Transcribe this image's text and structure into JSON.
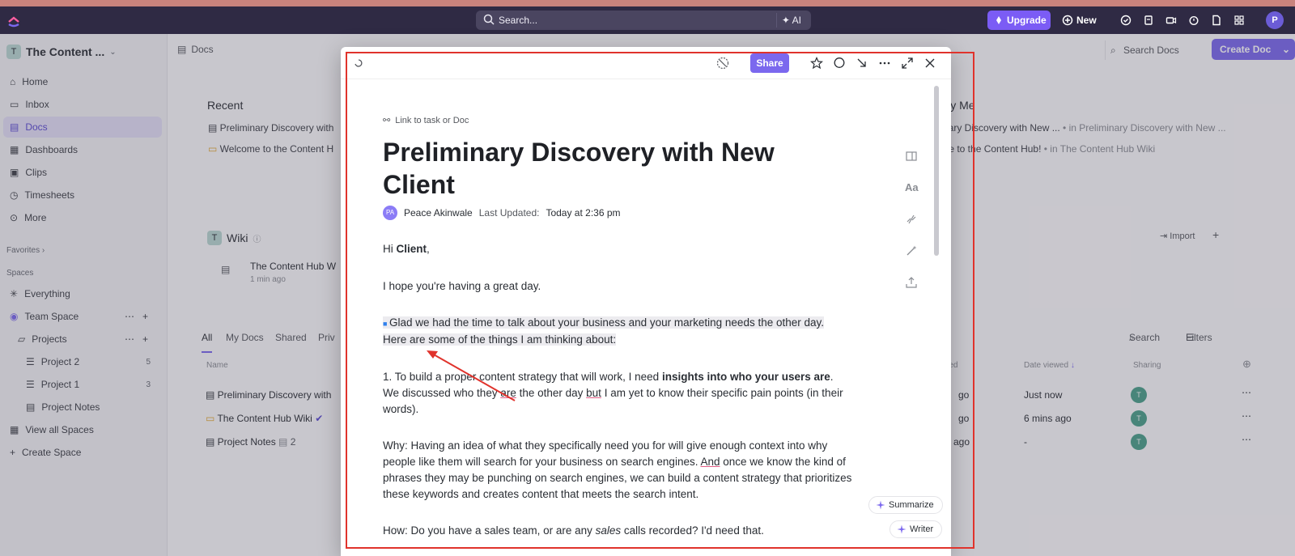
{
  "topbar": {
    "search_placeholder": "Search...",
    "ai_label": "AI",
    "upgrade_label": "Upgrade",
    "new_label": "New",
    "avatar_initial": "P"
  },
  "sidebar": {
    "workspace_badge": "T",
    "workspace_name": "The Content ...",
    "nav": [
      {
        "label": "Home",
        "icon": "home-icon"
      },
      {
        "label": "Inbox",
        "icon": "inbox-icon"
      },
      {
        "label": "Docs",
        "icon": "doc-icon"
      },
      {
        "label": "Dashboards",
        "icon": "dashboard-icon"
      },
      {
        "label": "Clips",
        "icon": "video-icon"
      },
      {
        "label": "Timesheets",
        "icon": "timer-icon"
      },
      {
        "label": "More",
        "icon": "more-icon"
      }
    ],
    "favorites_label": "Favorites",
    "spaces_label": "Spaces",
    "everything_label": "Everything",
    "team_space_label": "Team Space",
    "projects_label": "Projects",
    "project2_label": "Project 2",
    "project2_count": "5",
    "project1_label": "Project 1",
    "project1_count": "3",
    "project_notes_label": "Project Notes",
    "view_all_spaces": "View all Spaces",
    "create_space": "Create Space"
  },
  "main": {
    "breadcrumb": "Docs",
    "search_docs": "Search Docs",
    "create_doc": "Create Doc",
    "recent_title": "Recent",
    "recent_items": [
      "Preliminary Discovery with",
      "Welcome to the Content H"
    ],
    "created_by_me_title": "ed by Me",
    "created_items": [
      {
        "name": "liminary Discovery with New ...",
        "location": "• in Preliminary Discovery with New ..."
      },
      {
        "name": "lcome to the Content Hub!",
        "location": "• in The Content Hub Wiki"
      }
    ],
    "wiki_title": "Wiki",
    "wiki_card_title": "The Content Hub W",
    "wiki_card_time": "1 min ago",
    "import_label": "Import",
    "tabs": [
      "All",
      "My Docs",
      "Shared",
      "Priv"
    ],
    "search_label": "Search",
    "filters_label": "Filters",
    "col_name": "Name",
    "col_updated": "ated",
    "col_viewed": "Date viewed",
    "col_sharing": "Sharing",
    "rows": [
      {
        "name": "Preliminary Discovery with",
        "updated": "go",
        "viewed": "Just now",
        "share": "T"
      },
      {
        "name": "The Content Hub Wiki",
        "updated": "go",
        "viewed": "6 mins ago",
        "share": "T"
      },
      {
        "name": "Project Notes",
        "subcount": "2",
        "updated": "ago",
        "viewed": "-",
        "share": "T"
      }
    ]
  },
  "modal": {
    "share_label": "Share",
    "link_task": "Link to task or Doc",
    "title": "Preliminary Discovery with New Client",
    "author_initials": "PA",
    "author": "Peace Akinwale",
    "last_updated_label": "Last Updated:",
    "last_updated_value": "Today at 2:36 pm",
    "greeting_pre": "Hi ",
    "greeting_name": "Client",
    "greeting_post": ",",
    "p_hope": "I hope you're having a great day.",
    "p_glad": "Glad we had the time to talk about your business and your marketing needs the other day. Here are some of the things I am thinking about:",
    "p1_a": "1. To build a proper content strategy that will work, I need ",
    "p1_b": "insights into who your users are",
    "p1_c": ". We discussed who they ",
    "p1_are": "are",
    "p1_d": " the other day ",
    "p1_but": "but",
    "p1_e": " I am yet to know their specific pain points (in their words).",
    "why_a": "Why: Having an idea of what they specifically need you for will give enough context into why people like them will search for your business on search engines. ",
    "why_and": "And",
    "why_b": " once we know the kind of phrases they may be punching on search engines, we can build a content strategy that prioritizes these keywords and creates content that meets the search intent.",
    "how_a": "How: Do you have a sales team, or are any ",
    "how_sales": "sales",
    "how_b": " calls recorded? I'd need that.",
    "summarize": "Summarize",
    "writer": "Writer",
    "aa_label": "Aa"
  },
  "colors": {
    "accent": "#7b68ee",
    "topbar": "#2f2a44",
    "annotation": "#e0332c"
  }
}
